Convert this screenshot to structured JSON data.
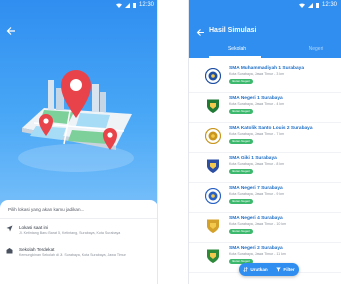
{
  "left_screen": {
    "status_time": "12:30",
    "prompt": "Pilih lokasi yang akan kamu jadikan...",
    "locations": [
      {
        "title": "Lokasi saat ini",
        "address": "Jl. Ketintang Baru Barat 5, Ketintang, Surabaya, Kota Surabaya"
      },
      {
        "title": "Sekolah Terdekat",
        "address": "Kemungkinan Sekolah di Jl. Surabaya, Kota Surabaya, Jawa Timur"
      }
    ]
  },
  "right_screen": {
    "status_time": "12:30",
    "title": "Hasil Simulasi",
    "tabs": [
      "Sekolah",
      "Negeri"
    ],
    "badge_label": "Ikutan Negeri",
    "schools": [
      {
        "name": "SMA Muhammadiyah 1 Surabaya",
        "address": "Kota Surabaya, Jawa Timur - 3 km",
        "logo_color": "#1f4fa3"
      },
      {
        "name": "SMA Negeri 1 Surabaya",
        "address": "Kota Surabaya, Jawa Timur - 4 km",
        "logo_color": "#1f7a36"
      },
      {
        "name": "SMA Katolik Santo Louis 2 Surabaya",
        "address": "Kota Surabaya, Jawa Timur - 7 km",
        "logo_color": "#c9961e"
      },
      {
        "name": "SMA Giki 1 Surabaya",
        "address": "Kota Surabaya, Jawa Timur - 8 km",
        "logo_color": "#2d4fa3"
      },
      {
        "name": "SMA Negeri 7 Surabaya",
        "address": "Kota Surabaya, Jawa Timur - 9 km",
        "logo_color": "#2a62c4"
      },
      {
        "name": "SMA Negeri 4 Surabaya",
        "address": "Kota Surabaya, Jawa Timur - 10 km",
        "logo_color": "#d4a12b"
      },
      {
        "name": "SMA Negeri 2 Surabaya",
        "address": "Kota Surabaya, Jawa Timur - 11 km",
        "logo_color": "#2e8a3b"
      }
    ],
    "fab": {
      "sort_label": "Urutkan",
      "filter_label": "Filter"
    }
  },
  "colors": {
    "primary": "#2f8ef0",
    "badge": "#3cb96d",
    "pin": "#e8434a"
  }
}
